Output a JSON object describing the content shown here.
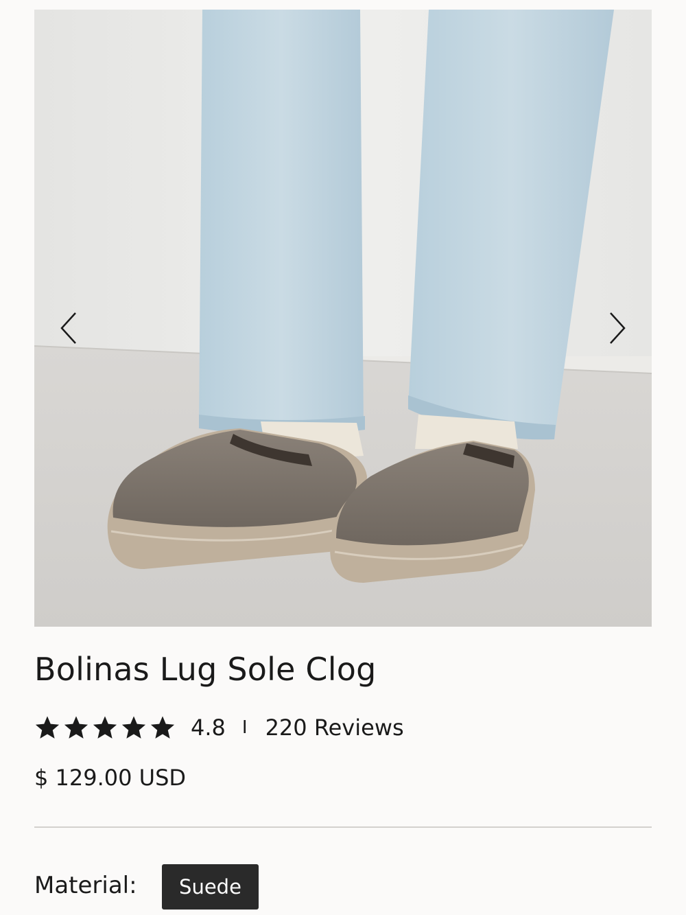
{
  "product": {
    "title": "Bolinas Lug Sole Clog",
    "rating_value": "4.8",
    "rating_separator": "I",
    "rating_stars": 5,
    "reviews_label": "220 Reviews",
    "price": "$ 129.00 USD"
  },
  "gallery": {
    "prev_icon": "chevron-left-icon",
    "next_icon": "chevron-right-icon"
  },
  "options": {
    "material_label": "Material:",
    "material_selected": "Suede"
  },
  "colors": {
    "selected_option_bg": "#2a2a2a",
    "star": "#1a1a1a",
    "page_bg": "#fbfaf9"
  }
}
